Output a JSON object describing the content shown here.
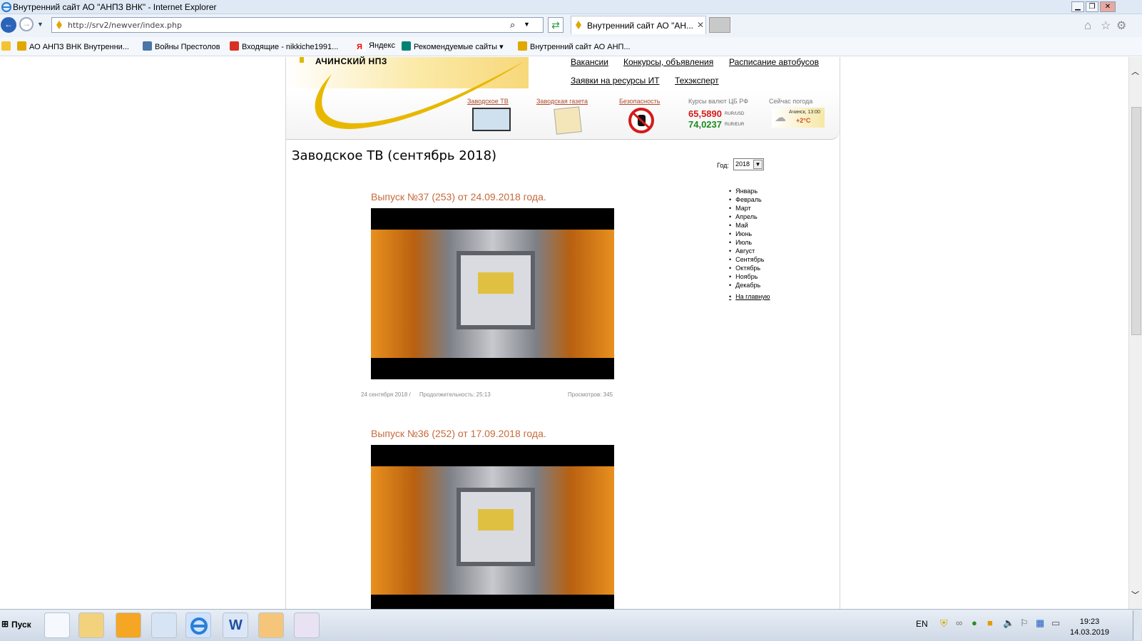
{
  "window": {
    "title": "Внутренний сайт АО \"АНПЗ ВНК\" - Internet Explorer"
  },
  "browser": {
    "url": "http://srv2/newver/index.php",
    "tab_title": "Внутренний сайт АО \"АН...",
    "favorites": [
      "АО АНПЗ ВНК Внутренни...",
      "Войны Престолов",
      "Входящие - nikkiche1991...",
      "Яндекс",
      "Рекомендуемые сайты",
      "Внутренний сайт АО АНП..."
    ]
  },
  "site": {
    "logo_text": "АЧИНСКИЙ НПЗ",
    "top_links": [
      "Вакансии",
      "Конкурсы, объявления",
      "Расписание автобусов",
      "Заявки на ресурсы ИТ",
      "Техэксперт"
    ],
    "banner": {
      "tv": "Заводское ТВ",
      "newspaper": "Заводская газета",
      "safety": "Безопасность",
      "rates_title": "Курсы валют ЦБ РФ",
      "usd": "65,5890",
      "usd_unit": "RUR/USD",
      "eur": "74,0237",
      "eur_unit": "RUR/EUR",
      "weather_title": "Сейчас погода",
      "weather_place": "Ачинск, 13:00",
      "weather_temp": "+2°С"
    }
  },
  "page": {
    "title": "Заводское ТВ  (сентябрь 2018)",
    "year_label": "Год:",
    "year_value": "2018",
    "months": [
      "Январь",
      "Февраль",
      "Март",
      "Апрель",
      "Май",
      "Июнь",
      "Июль",
      "Август",
      "Сентябрь",
      "Октябрь",
      "Ноябрь",
      "Декабрь"
    ],
    "home_link": "На главную",
    "issues": [
      {
        "title": "Выпуск №37 (253) от 24.09.2018 года.",
        "date": "24 сентября 2018 /",
        "duration": "Продолжительность: 25:13",
        "views": "Просмотров: 345"
      },
      {
        "title": "Выпуск №36 (252) от 17.09.2018 года."
      }
    ]
  },
  "taskbar": {
    "start": "Пуск",
    "lang": "EN",
    "time": "19:23",
    "date": "14.03.2019"
  }
}
